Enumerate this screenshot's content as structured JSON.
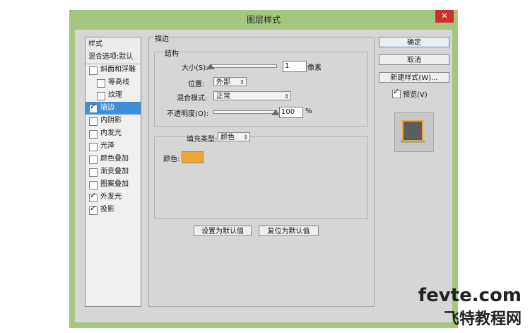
{
  "window": {
    "title": "图层样式",
    "close_glyph": "✕"
  },
  "style_list": {
    "items": [
      {
        "label": "样式",
        "type": "header"
      },
      {
        "label": "混合选项:默认",
        "type": "header"
      },
      {
        "label": "斜面和浮雕",
        "checked": false
      },
      {
        "label": "等高线",
        "checked": false,
        "indent": true
      },
      {
        "label": "纹理",
        "checked": false,
        "indent": true
      },
      {
        "label": "描边",
        "checked": true,
        "selected": true
      },
      {
        "label": "内阴影",
        "checked": false
      },
      {
        "label": "内发光",
        "checked": false
      },
      {
        "label": "光泽",
        "checked": false
      },
      {
        "label": "颜色叠加",
        "checked": false
      },
      {
        "label": "渐变叠加",
        "checked": false
      },
      {
        "label": "图案叠加",
        "checked": false
      },
      {
        "label": "外发光",
        "checked": true
      },
      {
        "label": "投影",
        "checked": true
      }
    ]
  },
  "stroke": {
    "section_title": "描边",
    "structure_title": "结构",
    "size_label": "大小(S):",
    "size_value": "1",
    "size_unit": "像素",
    "position_label": "位置:",
    "position_value": "外部",
    "blend_label": "混合模式:",
    "blend_value": "正常",
    "opacity_label": "不透明度(O):",
    "opacity_value": "100",
    "opacity_unit": "%",
    "fill_type_label": "填充类型:",
    "fill_type_value": "颜色",
    "color_label": "颜色:",
    "color_hex": "#f0a636",
    "size_slider_level": 0.0,
    "opacity_slider_level": 1.0
  },
  "defaults": {
    "set_default": "设置为默认值",
    "reset_default": "复位为默认值"
  },
  "actions": {
    "ok": "确定",
    "cancel": "取消",
    "new_style": "新建样式(W)...",
    "preview": "预览(V)",
    "preview_checked": true
  },
  "watermark": {
    "line1": "fevte.com",
    "line2": "飞特教程网"
  }
}
